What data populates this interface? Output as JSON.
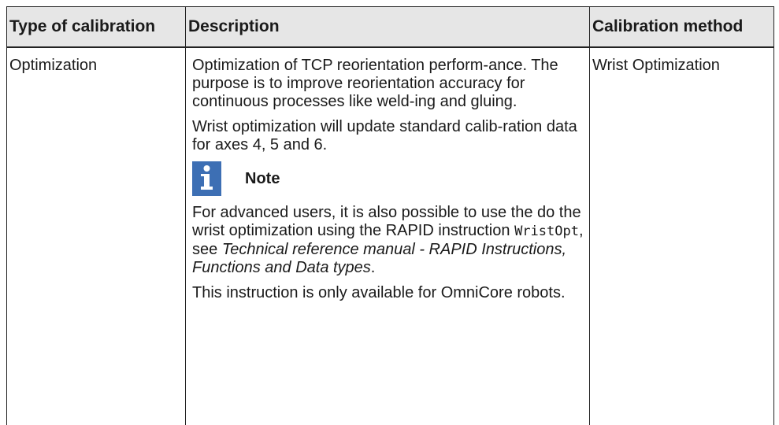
{
  "table": {
    "headers": {
      "type": "Type of calibration",
      "description": "Description",
      "method": "Calibration method"
    },
    "row": {
      "type": "Optimization",
      "method": "Wrist Optimization",
      "description": {
        "para1": "Optimization of TCP reorientation perform-ance. The purpose is to improve reorientation accuracy for continuous processes like weld-ing and gluing.",
        "para2": "Wrist optimization will update standard calib-ration data for axes 4, 5 and 6.",
        "note": {
          "icon": "info-icon",
          "label": "Note",
          "text1_before": "For advanced users, it is also possible to use the do the wrist optimization using the RAPID instruction ",
          "code": "WristOpt",
          "text1_mid": ", see ",
          "ref": "Technical reference manual - RAPID Instructions, Functions and Data types",
          "text1_end": ".",
          "text2": "This instruction is only available for OmniCore robots."
        }
      }
    }
  },
  "colors": {
    "header_bg": "#e6e6e6",
    "note_icon": "#3d6fb4",
    "border": "#222222"
  }
}
